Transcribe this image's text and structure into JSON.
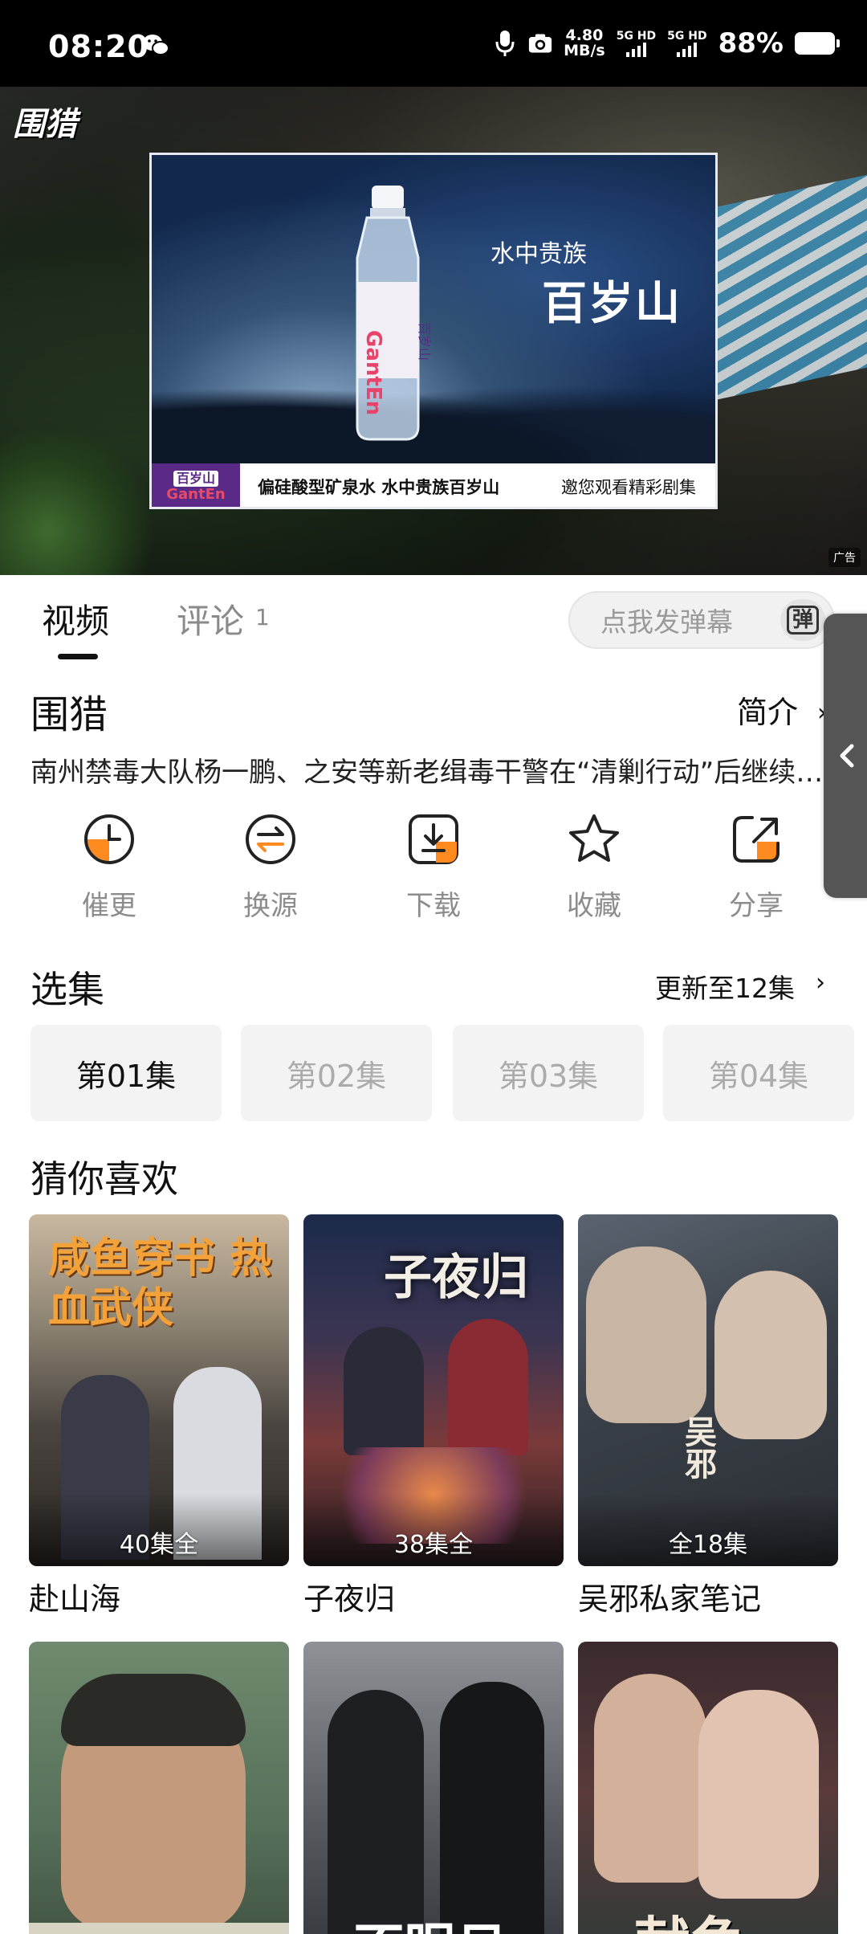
{
  "status_bar": {
    "time": "08:20",
    "speed_value": "4.80",
    "speed_unit": "MB/s",
    "net1": "5G HD",
    "net2": "5G HD",
    "battery": "88%"
  },
  "player": {
    "show_logo": "围猎",
    "ad": {
      "sub": "水中贵族",
      "title": "百岁山",
      "brand_cn": "百岁山",
      "brand_en": "GantEn",
      "slogan": "偏硅酸型矿泉水  水中贵族百岁山",
      "invite": "邀您观看精彩剧集",
      "badge": "广告"
    }
  },
  "tabs": {
    "video": "视频",
    "comment": "评论",
    "comment_count": "1",
    "danmu_placeholder": "点我发弹幕",
    "danmu_icon": "弹"
  },
  "show": {
    "title": "围猎",
    "intro_label": "简介",
    "description": "南州禁毒大队杨一鹏、之安等新老缉毒干警在“清剿行动”后继续追查毒源……"
  },
  "actions": [
    {
      "label": "催更",
      "icon": "clock-icon"
    },
    {
      "label": "换源",
      "icon": "switch-source-icon"
    },
    {
      "label": "下载",
      "icon": "download-icon"
    },
    {
      "label": "收藏",
      "icon": "star-icon"
    },
    {
      "label": "分享",
      "icon": "share-icon"
    }
  ],
  "episodes": {
    "section_title": "选集",
    "update_status": "更新至12集",
    "items": [
      "第01集",
      "第02集",
      "第03集",
      "第04集"
    ]
  },
  "recommend": {
    "section_title": "猜你喜欢",
    "items": [
      {
        "name": "赴山海",
        "count": "40集全",
        "poster_text": "咸鱼穿书 热血武侠"
      },
      {
        "name": "子夜归",
        "count": "38集全",
        "poster_text": "子夜归"
      },
      {
        "name": "吴邪私家笔记",
        "count": "全18集",
        "poster_text": "吴邪"
      },
      {
        "name": "",
        "count": "",
        "poster_text": ""
      },
      {
        "name": "",
        "count": "",
        "poster_text": "不眠日"
      },
      {
        "name": "",
        "count": "",
        "poster_text": "献鱼"
      }
    ]
  },
  "colors": {
    "accent_orange": "#ff8a1f",
    "inactive_gray": "#8c8c8c",
    "ad_purple": "#5a2a86"
  }
}
